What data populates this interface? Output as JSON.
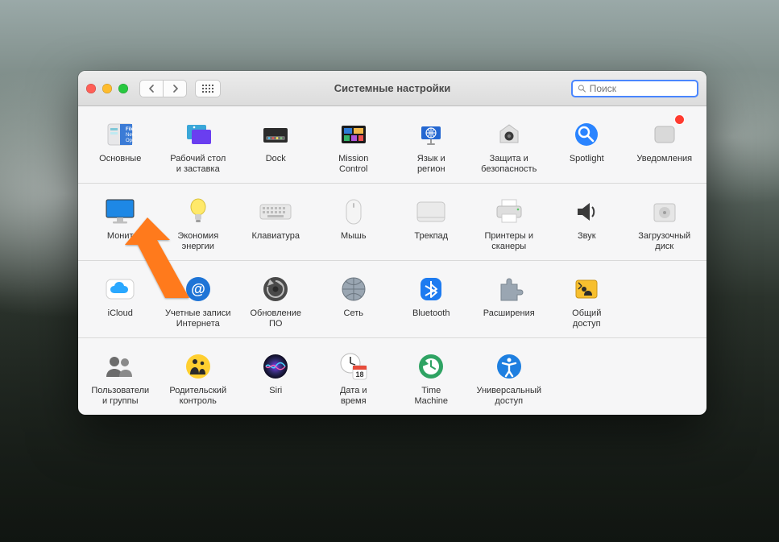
{
  "window_title": "Системные настройки",
  "search_placeholder": "Поиск",
  "rows": [
    [
      {
        "id": "general",
        "label": "Основные"
      },
      {
        "id": "desktop",
        "label": "Рабочий стол\nи заставка"
      },
      {
        "id": "dock",
        "label": "Dock"
      },
      {
        "id": "mission",
        "label": "Mission\nControl"
      },
      {
        "id": "language",
        "label": "Язык и\nрегион"
      },
      {
        "id": "security",
        "label": "Защита и\nбезопасность"
      },
      {
        "id": "spotlight",
        "label": "Spotlight"
      },
      {
        "id": "notifications",
        "label": "Уведомления",
        "badge": true
      }
    ],
    [
      {
        "id": "displays",
        "label": "Монит"
      },
      {
        "id": "energy",
        "label": "Экономия\nэнергии"
      },
      {
        "id": "keyboard",
        "label": "Клавиатура"
      },
      {
        "id": "mouse",
        "label": "Мышь"
      },
      {
        "id": "trackpad",
        "label": "Трекпад"
      },
      {
        "id": "printers",
        "label": "Принтеры и\nсканеры"
      },
      {
        "id": "sound",
        "label": "Звук"
      },
      {
        "id": "startupdisk",
        "label": "Загрузочный\nдиск"
      }
    ],
    [
      {
        "id": "icloud",
        "label": "iCloud"
      },
      {
        "id": "internet",
        "label": "Учетные записи\nИнтернета"
      },
      {
        "id": "swupdate",
        "label": "Обновление\nПО"
      },
      {
        "id": "network",
        "label": "Сеть"
      },
      {
        "id": "bluetooth",
        "label": "Bluetooth"
      },
      {
        "id": "extensions",
        "label": "Расширения"
      },
      {
        "id": "sharing",
        "label": "Общий\nдоступ"
      }
    ],
    [
      {
        "id": "users",
        "label": "Пользователи\nи группы"
      },
      {
        "id": "parental",
        "label": "Родительский\nконтроль"
      },
      {
        "id": "siri",
        "label": "Siri"
      },
      {
        "id": "datetime",
        "label": "Дата и\nвремя"
      },
      {
        "id": "timemachine",
        "label": "Time\nMachine"
      },
      {
        "id": "accessibility",
        "label": "Универсальный\nдоступ"
      }
    ]
  ]
}
